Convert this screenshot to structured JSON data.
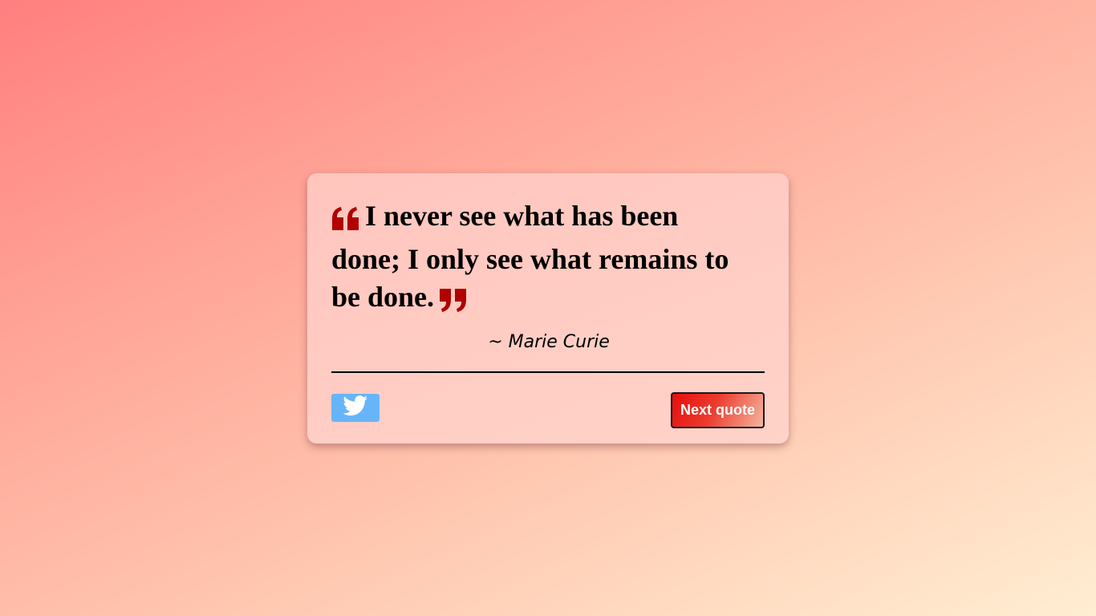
{
  "quote": {
    "text": "I never see what has been done; I only see what remains to be done.",
    "author": "~ Marie Curie",
    "open_quote_icon": "quote-left-icon",
    "close_quote_icon": "quote-right-icon",
    "quote_mark_color": "#b00000"
  },
  "actions": {
    "tweet_icon": "twitter-icon",
    "tweet_color": "#66b5f8",
    "next_label": "Next quote"
  }
}
